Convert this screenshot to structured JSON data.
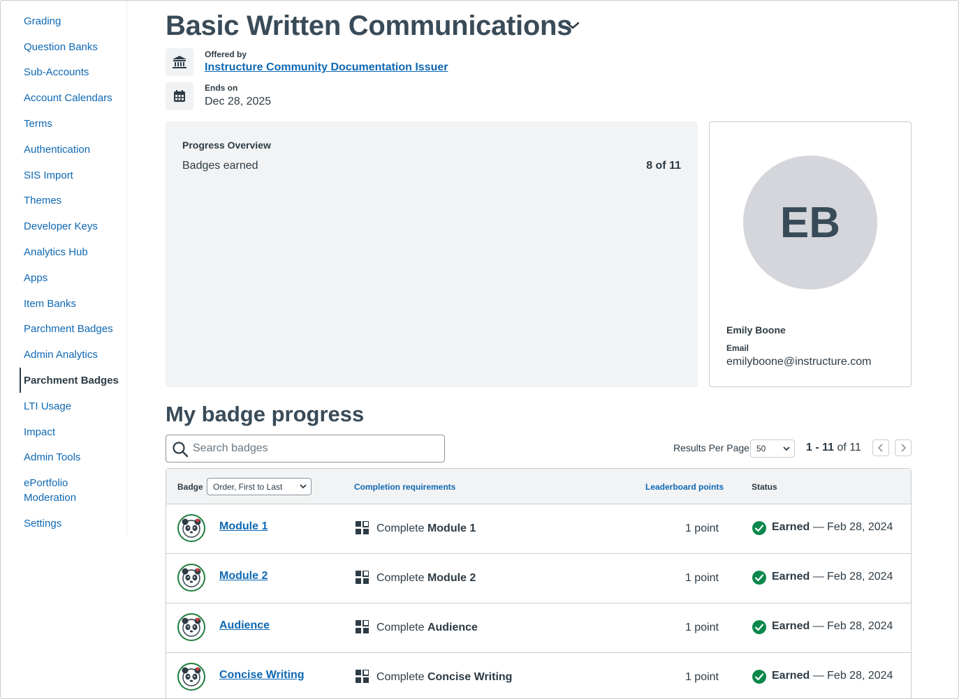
{
  "sidebar": {
    "items": [
      {
        "label": "Grading"
      },
      {
        "label": "Question Banks"
      },
      {
        "label": "Sub-Accounts"
      },
      {
        "label": "Account Calendars"
      },
      {
        "label": "Terms"
      },
      {
        "label": "Authentication"
      },
      {
        "label": "SIS Import"
      },
      {
        "label": "Themes"
      },
      {
        "label": "Developer Keys"
      },
      {
        "label": "Analytics Hub"
      },
      {
        "label": "Apps"
      },
      {
        "label": "Item Banks"
      },
      {
        "label": "Parchment Badges"
      },
      {
        "label": "Admin Analytics"
      },
      {
        "label": "Parchment Badges",
        "active": true
      },
      {
        "label": "LTI Usage"
      },
      {
        "label": "Impact"
      },
      {
        "label": "Admin Tools"
      },
      {
        "label": "ePortfolio Moderation"
      },
      {
        "label": "Settings"
      }
    ]
  },
  "header": {
    "title": "Basic Written Communications",
    "offered_by_label": "Offered by",
    "offered_by_value": "Instructure Community Documentation Issuer",
    "ends_on_label": "Ends on",
    "ends_on_value": "Dec 28, 2025"
  },
  "progress_overview": {
    "title": "Progress Overview",
    "badges_label": "Badges earned",
    "badges_value": "8 of 11"
  },
  "profile": {
    "initials": "EB",
    "name": "Emily Boone",
    "email_label": "Email",
    "email": "emilyboone@instructure.com"
  },
  "badge_progress": {
    "title": "My badge progress",
    "search_placeholder": "Search badges",
    "results_per_page_label": "Results Per Page",
    "results_per_page_value": "50",
    "pager_range": "1 - 11",
    "pager_of": "of 11",
    "columns": {
      "badge": "Badge",
      "order": "Order, First to Last",
      "requirements": "Completion requirements",
      "points": "Leaderboard points",
      "status": "Status"
    },
    "rows": [
      {
        "name": "Module 1",
        "req_prefix": "Complete",
        "req_item": "Module 1",
        "points": "1 point",
        "status": "Earned",
        "date": "— Feb 28, 2024"
      },
      {
        "name": "Module 2",
        "req_prefix": "Complete",
        "req_item": "Module 2",
        "points": "1 point",
        "status": "Earned",
        "date": "— Feb 28, 2024"
      },
      {
        "name": "Audience",
        "req_prefix": "Complete",
        "req_item": "Audience",
        "points": "1 point",
        "status": "Earned",
        "date": "— Feb 28, 2024"
      },
      {
        "name": "Concise Writing",
        "req_prefix": "Complete",
        "req_item": "Concise Writing",
        "points": "1 point",
        "status": "Earned",
        "date": "— Feb 28, 2024"
      }
    ]
  },
  "colors": {
    "link": "#0e68b3",
    "text": "#2d3b45",
    "earned_green": "#0b874b"
  }
}
